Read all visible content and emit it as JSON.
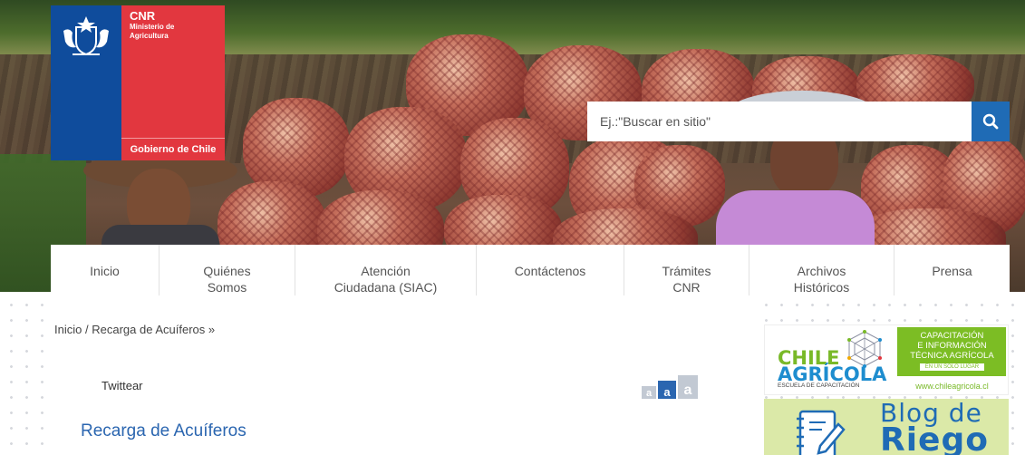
{
  "logo": {
    "acronym": "CNR",
    "ministry_line1": "Ministerio de",
    "ministry_line2": "Agricultura",
    "government": "Gobierno de Chile"
  },
  "search": {
    "placeholder": "Ej.:\"Buscar en sitio\""
  },
  "nav": {
    "items": [
      {
        "line1": "Inicio",
        "line2": ""
      },
      {
        "line1": "Quiénes",
        "line2": "Somos"
      },
      {
        "line1": "Atención",
        "line2": "Ciudadana (SIAC)"
      },
      {
        "line1": "Contáctenos",
        "line2": ""
      },
      {
        "line1": "Trámites",
        "line2": "CNR"
      },
      {
        "line1": "Archivos",
        "line2": "Históricos"
      },
      {
        "line1": "Prensa",
        "line2": ""
      }
    ]
  },
  "breadcrumb": {
    "home": "Inicio",
    "separator": "/",
    "current": "Recarga de Acuíferos »"
  },
  "social": {
    "twitter": "Twittear"
  },
  "font_size": {
    "small": "a",
    "medium": "a",
    "large": "a"
  },
  "page": {
    "title": "Recarga de Acuíferos"
  },
  "banners": {
    "chile_agricola": {
      "word1": "CHILE",
      "word2": "AGRÍCOLA",
      "tagline": "ESCUELA DE CAPACITACIÓN",
      "right_line1": "CAPACITACIÓN",
      "right_line2": "E INFORMACIÓN",
      "right_line3": "TÉCNICA AGRÍCOLA",
      "right_line4": "EN UN SOLO LUGAR",
      "url": "www.chileagricola.cl"
    },
    "blog_riego": {
      "word1": "Blog de",
      "word2": "Riego"
    }
  },
  "colors": {
    "gov_blue": "#0f4c9c",
    "gov_red": "#e2373f",
    "link_blue": "#2b66b0",
    "search_button": "#1f6bb5",
    "chile_agricola_green": "#7cbd24"
  },
  "icons": {
    "search_button": "search-icon",
    "logo_crest": "coat-of-arms-icon",
    "banner_geo": "geodesic-icon",
    "banner_notebook": "notebook-pencil-icon"
  }
}
